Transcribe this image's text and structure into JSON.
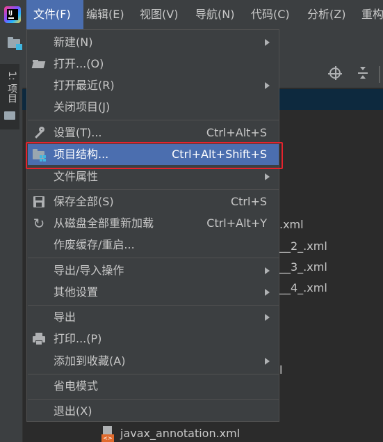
{
  "menubar": {
    "logo_label": "IJ",
    "items": [
      "文件(F)",
      "编辑(E)",
      "视图(V)",
      "导航(N)",
      "代码(C)",
      "分析(Z)",
      "重构"
    ]
  },
  "sidebar": {
    "project_tab_label": "1: 项目"
  },
  "tree": {
    "items": [
      ".xml",
      "__2_.xml",
      "__3_.xml",
      "__4_.xml",
      "l",
      "javax_annotation.xml"
    ]
  },
  "file_menu": {
    "items": [
      {
        "label": "新建(N)",
        "shortcut": "",
        "submenu": true
      },
      {
        "label": "打开...(O)",
        "shortcut": "",
        "icon": "open-folder-icon"
      },
      {
        "label": "打开最近(R)",
        "shortcut": "",
        "submenu": true
      },
      {
        "label": "关闭项目(J)",
        "shortcut": ""
      },
      {
        "label": "设置(T)...",
        "shortcut": "Ctrl+Alt+S",
        "icon": "wrench-icon"
      },
      {
        "label": "项目结构...",
        "shortcut": "Ctrl+Alt+Shift+S",
        "icon": "project-structure-icon",
        "highlighted": true
      },
      {
        "label": "文件属性",
        "shortcut": "",
        "submenu": true
      },
      {
        "label": "保存全部(S)",
        "shortcut": "Ctrl+S",
        "icon": "save-icon"
      },
      {
        "label": "从磁盘全部重新加载",
        "shortcut": "Ctrl+Alt+Y",
        "icon": "reload-icon"
      },
      {
        "label": "作废缓存/重启...",
        "shortcut": ""
      },
      {
        "label": "导出/导入操作",
        "shortcut": "",
        "submenu": true
      },
      {
        "label": "其他设置",
        "shortcut": "",
        "submenu": true
      },
      {
        "label": "导出",
        "shortcut": "",
        "submenu": true
      },
      {
        "label": "打印...(P)",
        "shortcut": "",
        "icon": "print-icon"
      },
      {
        "label": "添加到收藏(A)",
        "shortcut": "",
        "submenu": true
      },
      {
        "label": "省电模式",
        "shortcut": ""
      },
      {
        "label": "退出(X)",
        "shortcut": ""
      }
    ]
  },
  "colors": {
    "menu_highlight": "#4b6eaf",
    "annotation_box": "#e5232d",
    "background": "#2b2b2b"
  }
}
